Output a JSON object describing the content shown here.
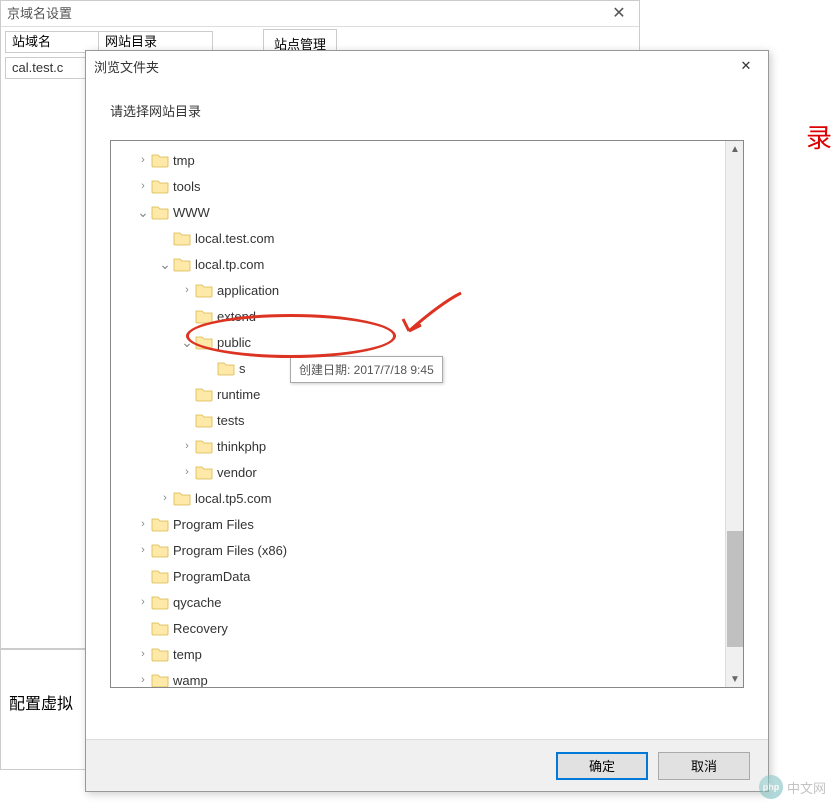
{
  "bg": {
    "title": "京域名设置",
    "close": "✕",
    "header_col1": "站域名",
    "header_col2": "网站目录",
    "input_col1": "cal.test.c",
    "tab": "站点管理",
    "bottom": "配置虚拟"
  },
  "red_char": "录",
  "dialog": {
    "title": "浏览文件夹",
    "close": "✕",
    "prompt": "请选择网站目录",
    "ok": "确定",
    "cancel": "取消"
  },
  "tree": [
    {
      "level": 1,
      "arrow": ">",
      "name": "tmp",
      "expanded": false
    },
    {
      "level": 1,
      "arrow": ">",
      "name": "tools",
      "expanded": false
    },
    {
      "level": 1,
      "arrow": "v",
      "name": "WWW",
      "expanded": true
    },
    {
      "level": 2,
      "arrow": "",
      "name": "local.test.com",
      "expanded": false
    },
    {
      "level": 2,
      "arrow": "v",
      "name": "local.tp.com",
      "expanded": true
    },
    {
      "level": 3,
      "arrow": ">",
      "name": "application",
      "expanded": false
    },
    {
      "level": 3,
      "arrow": "",
      "name": "extend",
      "expanded": false
    },
    {
      "level": 3,
      "arrow": "v",
      "name": "public",
      "expanded": true,
      "selected": true
    },
    {
      "level": 4,
      "arrow": "",
      "name": "s",
      "expanded": false
    },
    {
      "level": 3,
      "arrow": "",
      "name": "runtime",
      "expanded": false
    },
    {
      "level": 3,
      "arrow": "",
      "name": "tests",
      "expanded": false
    },
    {
      "level": 3,
      "arrow": ">",
      "name": "thinkphp",
      "expanded": false
    },
    {
      "level": 3,
      "arrow": ">",
      "name": "vendor",
      "expanded": false
    },
    {
      "level": 2,
      "arrow": ">",
      "name": "local.tp5.com",
      "expanded": false
    },
    {
      "level": 1,
      "arrow": ">",
      "name": "Program Files",
      "expanded": false
    },
    {
      "level": 1,
      "arrow": ">",
      "name": "Program Files (x86)",
      "expanded": false
    },
    {
      "level": 1,
      "arrow": "",
      "name": "ProgramData",
      "expanded": false
    },
    {
      "level": 1,
      "arrow": ">",
      "name": "qycache",
      "expanded": false
    },
    {
      "level": 1,
      "arrow": "",
      "name": "Recovery",
      "expanded": false
    },
    {
      "level": 1,
      "arrow": ">",
      "name": "temp",
      "expanded": false
    },
    {
      "level": 1,
      "arrow": ">",
      "name": "wamp",
      "expanded": false
    }
  ],
  "tooltip": "创建日期: 2017/7/18 9:45",
  "scrollbar": {
    "up": "▲",
    "down": "▼"
  },
  "watermark": {
    "logo": "php",
    "text": "中文网"
  }
}
